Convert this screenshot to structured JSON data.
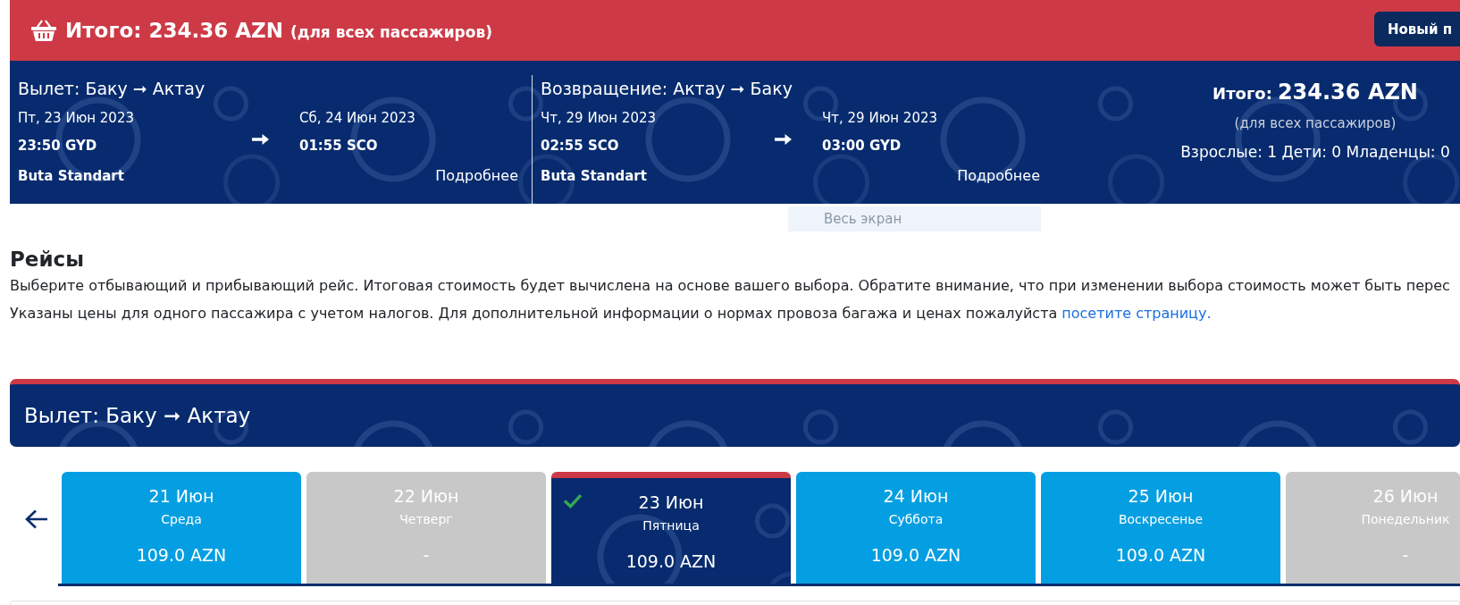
{
  "header": {
    "title": "Итого: 234.36 AZN",
    "note": "(для всех пассажиров)",
    "button": "Новый п"
  },
  "summary": {
    "legs": [
      {
        "title": "Вылет: Баку ➞ Актау",
        "depart_date": "Пт, 23 Июн 2023",
        "depart_time": "23:50 GYD",
        "arrive_date": "Сб, 24 Июн 2023",
        "arrive_time": "01:55 SCO",
        "fare": "Buta Standart",
        "details": "Подробнее"
      },
      {
        "title": "Возвращение: Актау ➞ Баку",
        "depart_date": "Чт, 29 Июн 2023",
        "depart_time": "02:55 SCO",
        "arrive_date": "Чт, 29 Июн 2023",
        "arrive_time": "03:00 GYD",
        "fare": "Buta Standart",
        "details": "Подробнее"
      }
    ],
    "total": {
      "label": "Итого:",
      "amount": "234.36 AZN",
      "note": "(для всех пассажиров)",
      "passengers": "Взрослые: 1 Дети: 0 Младенцы: 0"
    }
  },
  "tooltip": "Весь экран",
  "flights": {
    "title": "Рейсы",
    "intro": "Выберите отбывающий и прибывающий рейс. Итоговая стоимость будет вычислена на основе вашего выбора. Обратите внимание, что при изменении выбора стоимость может быть перес",
    "prices_note": "Указаны цены для одного пассажира с учетом налогов. Для дополнительной информации о нормах провоза багажа и ценах пожалуйста",
    "link": "посетите страницу."
  },
  "departure": {
    "title": "Вылет: Баку ➞ Актау",
    "dates": [
      {
        "date": "21 Июн",
        "weekday": "Среда",
        "price": "109.0 AZN",
        "available": true,
        "selected": false
      },
      {
        "date": "22 Июн",
        "weekday": "Четверг",
        "price": "-",
        "available": false,
        "selected": false
      },
      {
        "date": "23 Июн",
        "weekday": "Пятница",
        "price": "109.0 AZN",
        "available": true,
        "selected": true
      },
      {
        "date": "24 Июн",
        "weekday": "Суббота",
        "price": "109.0 AZN",
        "available": true,
        "selected": false
      },
      {
        "date": "25 Июн",
        "weekday": "Воскресенье",
        "price": "109.0 AZN",
        "available": true,
        "selected": false
      },
      {
        "date": "26 Июн",
        "weekday": "Понедельник",
        "price": "-",
        "available": false,
        "selected": false
      }
    ]
  }
}
